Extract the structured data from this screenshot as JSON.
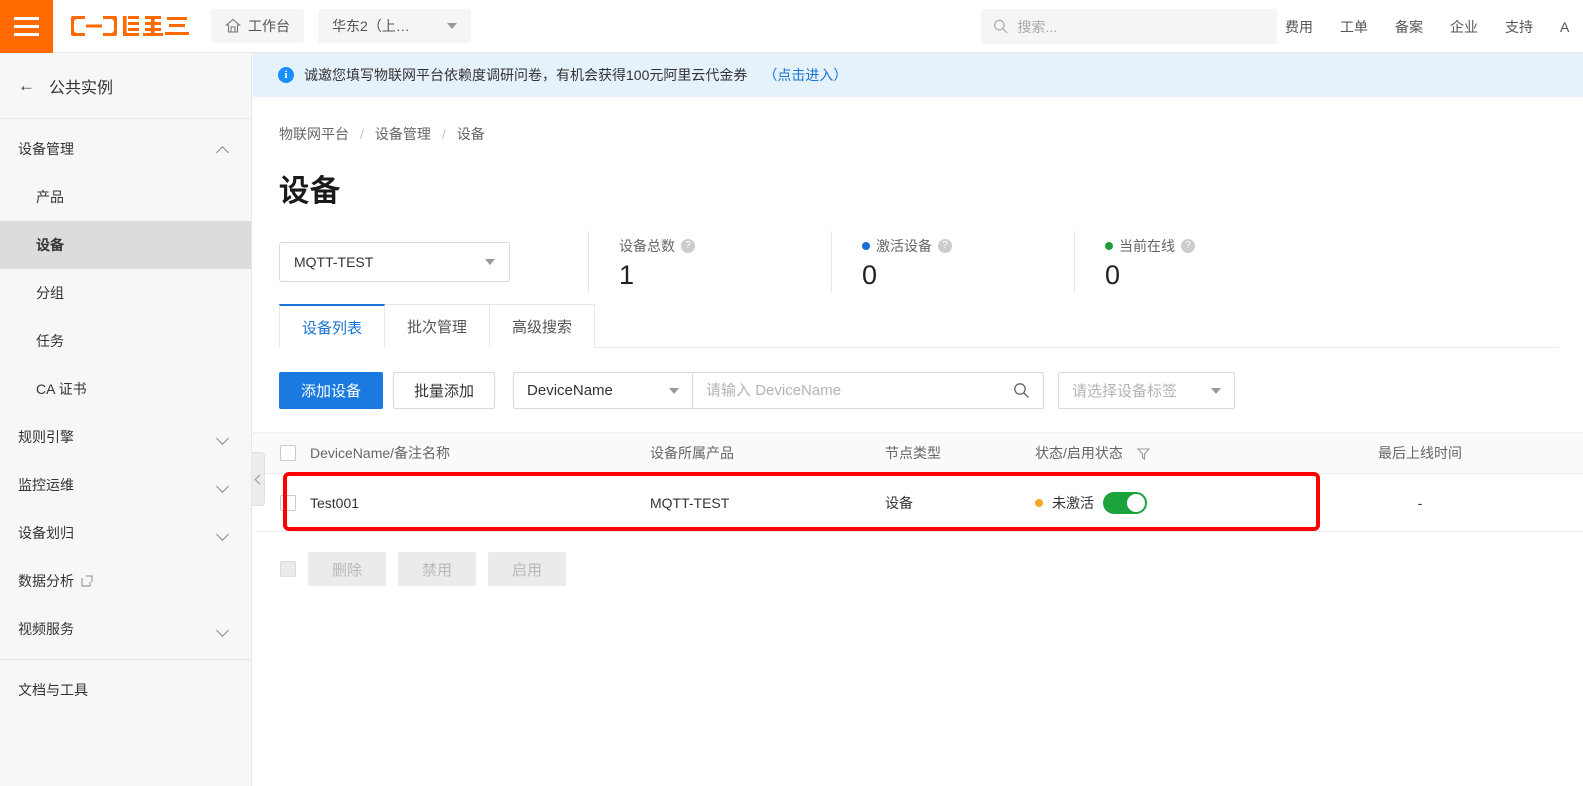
{
  "header": {
    "menu_icon": "hamburger-icon",
    "logo_text": "阿里云",
    "workbench_label": "工作台",
    "region_label": "华东2（上…",
    "search_placeholder": "搜索...",
    "nav": [
      {
        "label": "费用"
      },
      {
        "label": "工单"
      },
      {
        "label": "备案"
      },
      {
        "label": "企业"
      },
      {
        "label": "支持"
      }
    ],
    "account_partial": "A"
  },
  "sidebar": {
    "back_label": "公共实例",
    "groups": [
      {
        "label": "设备管理",
        "expanded": true,
        "children": [
          {
            "label": "产品",
            "active": false
          },
          {
            "label": "设备",
            "active": true
          },
          {
            "label": "分组",
            "active": false
          },
          {
            "label": "任务",
            "active": false
          },
          {
            "label": "CA 证书",
            "active": false
          }
        ]
      },
      {
        "label": "规则引擎",
        "expanded": false
      },
      {
        "label": "监控运维",
        "expanded": false
      },
      {
        "label": "设备划归",
        "expanded": false
      }
    ],
    "data_analysis": "数据分析",
    "video_service": "视频服务",
    "docs_tools": "文档与工具"
  },
  "notice": {
    "text": "诚邀您填写物联网平台依赖度调研问卷，有机会获得100元阿里云代金券",
    "link": "（点击进入）"
  },
  "breadcrumb": {
    "items": [
      "物联网平台",
      "设备管理",
      "设备"
    ],
    "separator": "/"
  },
  "page": {
    "title": "设备"
  },
  "filters": {
    "product_selected": "MQTT-TEST"
  },
  "stats": [
    {
      "label": "设备总数",
      "value": "1",
      "dot": ""
    },
    {
      "label": "激活设备",
      "value": "0",
      "dot": "#1a6fd4"
    },
    {
      "label": "当前在线",
      "value": "0",
      "dot": "#1f9d3c"
    }
  ],
  "tabs": [
    {
      "label": "设备列表",
      "active": true
    },
    {
      "label": "批次管理",
      "active": false
    },
    {
      "label": "高级搜索",
      "active": false
    }
  ],
  "toolbar": {
    "add_device": "添加设备",
    "batch_add": "批量添加",
    "search_field_selected": "DeviceName",
    "search_placeholder": "请输入 DeviceName",
    "tag_select_placeholder": "请选择设备标签"
  },
  "table": {
    "columns": [
      "DeviceName/备注名称",
      "设备所属产品",
      "节点类型",
      "状态/启用状态",
      "最后上线时间"
    ],
    "rows": [
      {
        "name": "Test001",
        "product": "MQTT-TEST",
        "node_type": "设备",
        "status": "未激活",
        "status_dot": "#f5a623",
        "enabled": true,
        "last_online": "-"
      }
    ]
  },
  "bulk_actions": [
    {
      "label": "删除",
      "disabled": true
    },
    {
      "label": "禁用",
      "disabled": true
    },
    {
      "label": "启用",
      "disabled": true
    }
  ],
  "annotation": {
    "highlight_color": "#ff0000"
  }
}
